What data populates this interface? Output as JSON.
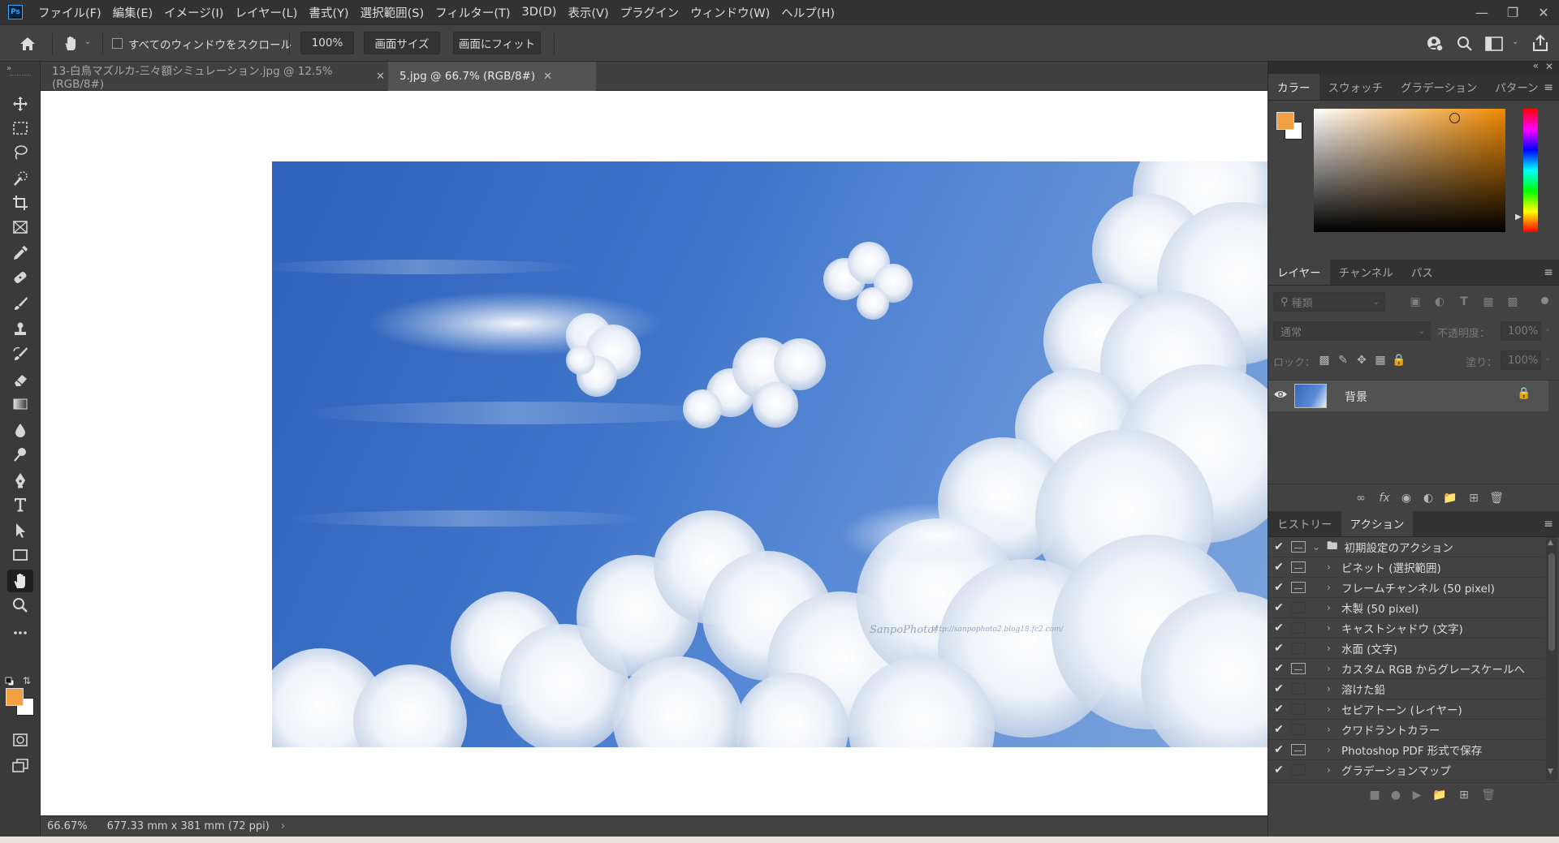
{
  "app": {
    "logo_text": "Ps"
  },
  "menu": [
    "ファイル(F)",
    "編集(E)",
    "イメージ(I)",
    "レイヤー(L)",
    "書式(Y)",
    "選択範囲(S)",
    "フィルター(T)",
    "3D(D)",
    "表示(V)",
    "プラグイン",
    "ウィンドウ(W)",
    "ヘルプ(H)"
  ],
  "options": {
    "scroll_all_label": "すべてのウィンドウをスクロール",
    "zoom_value": "100%",
    "fit_screen_label": "画面サイズ",
    "fill_screen_label": "画面にフィット"
  },
  "tabs": [
    {
      "label": "13-白鳥マズルカ-三々額シミュレーション.jpg @ 12.5% (RGB/8#)",
      "active": false
    },
    {
      "label": "5.jpg @ 66.7% (RGB/8#)",
      "active": true
    }
  ],
  "canvas": {
    "watermark_brand": "SanpoPhoto!",
    "watermark_url": "http://sanpophoto2.blog18.fc2.com/"
  },
  "status": {
    "zoom": "66.67%",
    "doc_size": "677.33 mm x 381 mm (72 ppi)"
  },
  "colors": {
    "foreground": "#f0a040",
    "background": "#ffffff"
  },
  "color_panel": {
    "tabs": [
      "カラー",
      "スウォッチ",
      "グラデーション",
      "パターン"
    ],
    "active_tab": "カラー"
  },
  "layers_panel": {
    "tabs": [
      "レイヤー",
      "チャンネル",
      "パス"
    ],
    "filter_placeholder": "種類",
    "blend_mode": "通常",
    "opacity_label": "不透明度：",
    "opacity_value": "100%",
    "lock_label": "ロック：",
    "fill_label": "塗り：",
    "fill_value": "100%",
    "layers": [
      {
        "name": "背景",
        "visible": true,
        "locked": true
      }
    ]
  },
  "actions_panel": {
    "tabs": [
      "ヒストリー",
      "アクション"
    ],
    "set_name": "初期設定のアクション",
    "items": [
      {
        "label": "ビネット (選択範囲)",
        "dialog": true
      },
      {
        "label": "フレームチャンネル (50 pixel)",
        "dialog": true
      },
      {
        "label": "木製 (50 pixel)",
        "dialog": false
      },
      {
        "label": "キャストシャドウ (文字)",
        "dialog": false
      },
      {
        "label": "水面 (文字)",
        "dialog": false
      },
      {
        "label": "カスタム RGB からグレースケールへ",
        "dialog": true
      },
      {
        "label": "溶けた鉛",
        "dialog": false
      },
      {
        "label": "セピアトーン (レイヤー)",
        "dialog": false
      },
      {
        "label": "クワドラントカラー",
        "dialog": false
      },
      {
        "label": "Photoshop PDF 形式で保存",
        "dialog": true
      },
      {
        "label": "グラデーションマップ",
        "dialog": false
      }
    ]
  }
}
